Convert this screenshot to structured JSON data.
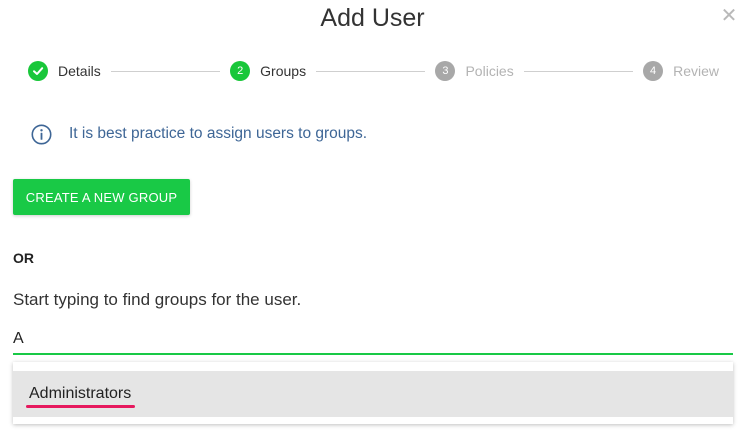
{
  "dialog": {
    "title": "Add User",
    "close_icon": "close-icon"
  },
  "stepper": {
    "steps": [
      {
        "number": "1",
        "label": "Details",
        "state": "done"
      },
      {
        "number": "2",
        "label": "Groups",
        "state": "active"
      },
      {
        "number": "3",
        "label": "Policies",
        "state": "pending"
      },
      {
        "number": "4",
        "label": "Review",
        "state": "pending"
      }
    ]
  },
  "info": {
    "icon": "info-icon",
    "text": "It is best practice to assign users to groups."
  },
  "create_button": {
    "label": "CREATE A NEW GROUP"
  },
  "or_label": "OR",
  "search": {
    "prompt": "Start typing to find groups for the user.",
    "value": "A"
  },
  "results": [
    {
      "label": "Administrators"
    }
  ],
  "colors": {
    "accent": "#19c946",
    "info_text": "#3e6696",
    "pending": "#a8a8a8",
    "highlight": "#e6195e"
  }
}
